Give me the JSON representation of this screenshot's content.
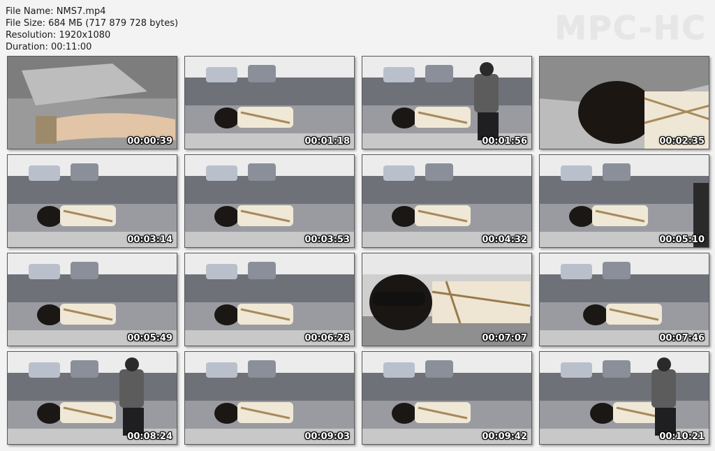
{
  "file_info": {
    "name_line": "File Name: NMS7.mp4",
    "size_line": "File Size: 684 МБ (717 879 728 bytes)",
    "resolution_line": "Resolution: 1920x1080",
    "duration_line": "Duration: 00:11:00"
  },
  "logo": "MPC-HC",
  "thumbnails": [
    {
      "time": "00:00:39",
      "scene": "closeup-arm"
    },
    {
      "time": "00:01:18",
      "scene": "couch-wide"
    },
    {
      "time": "00:01:56",
      "scene": "couch-person"
    },
    {
      "time": "00:02:35",
      "scene": "closeup-head"
    },
    {
      "time": "00:03:14",
      "scene": "couch-close"
    },
    {
      "time": "00:03:53",
      "scene": "couch-wide"
    },
    {
      "time": "00:04:32",
      "scene": "couch-angle"
    },
    {
      "time": "00:05:10",
      "scene": "couch-dark"
    },
    {
      "time": "00:05:49",
      "scene": "couch-close"
    },
    {
      "time": "00:06:28",
      "scene": "couch-close"
    },
    {
      "time": "00:07:07",
      "scene": "closeup-face"
    },
    {
      "time": "00:07:46",
      "scene": "couch-far"
    },
    {
      "time": "00:08:24",
      "scene": "couch-person"
    },
    {
      "time": "00:09:03",
      "scene": "couch-close"
    },
    {
      "time": "00:09:42",
      "scene": "couch-wide"
    },
    {
      "time": "00:10:21",
      "scene": "couch-person-far"
    }
  ]
}
